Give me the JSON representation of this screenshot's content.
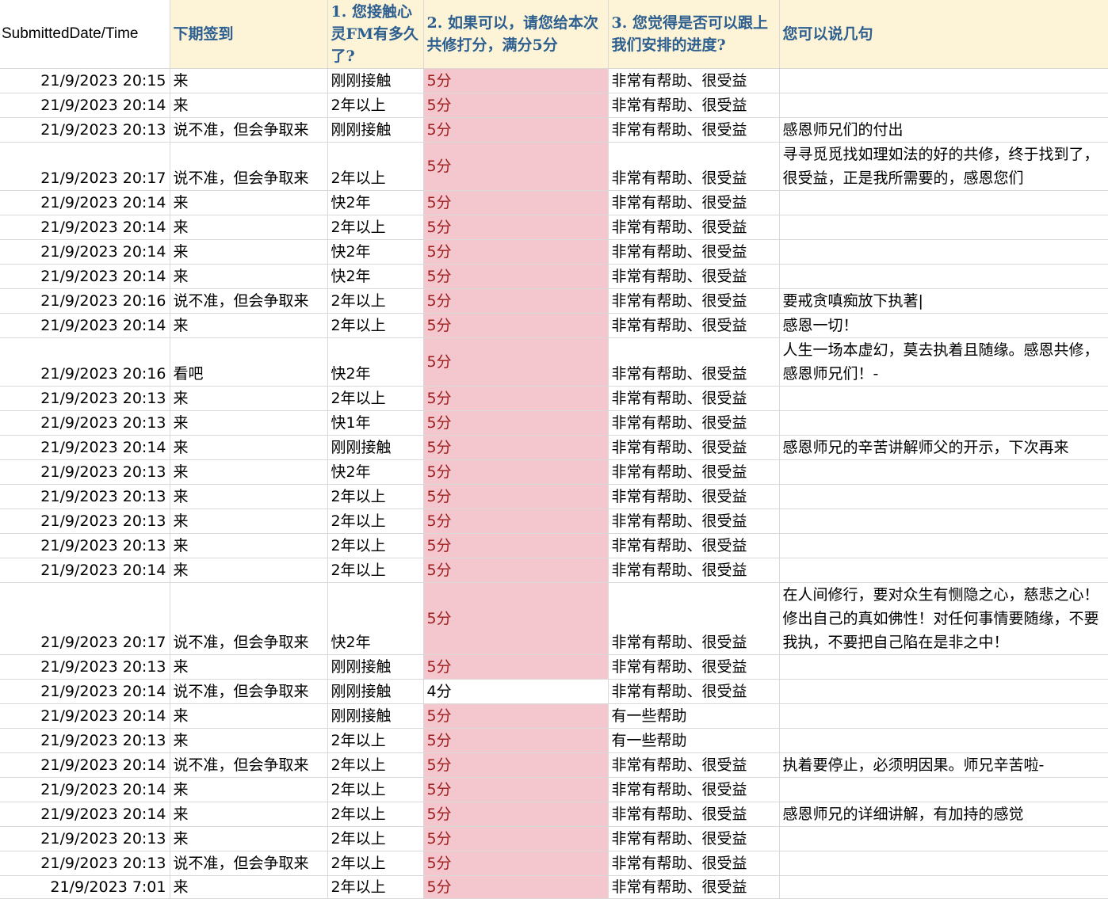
{
  "headers": [
    "SubmittedDate/Time",
    "下期签到",
    "1. 您接触心灵FM有多久了?",
    "2. 如果可以，请您给本次共修打分，满分5分",
    "3. 您觉得是否可以跟上我们安排的进度?",
    "您可以说几句"
  ],
  "rows": [
    {
      "time": "21/9/2023 20:15",
      "signin": "来",
      "duration": "刚刚接触",
      "score": "5分",
      "progress": "非常有帮助、很受益",
      "comment": ""
    },
    {
      "time": "21/9/2023 20:14",
      "signin": "来",
      "duration": "2年以上",
      "score": "5分",
      "progress": "非常有帮助、很受益",
      "comment": ""
    },
    {
      "time": "21/9/2023 20:13",
      "signin": "说不准，但会争取来",
      "duration": "刚刚接触",
      "score": "5分",
      "progress": "非常有帮助、很受益",
      "comment": "感恩师兄们的付出"
    },
    {
      "time": "21/9/2023 20:17",
      "signin": "说不准，但会争取来",
      "duration": "2年以上",
      "score": "5分",
      "progress": "非常有帮助、很受益",
      "comment": "寻寻觅觅找如理如法的好的共修，终于找到了，很受益，正是我所需要的，感恩您们"
    },
    {
      "time": "21/9/2023 20:14",
      "signin": "来",
      "duration": "快2年",
      "score": "5分",
      "progress": "非常有帮助、很受益",
      "comment": ""
    },
    {
      "time": "21/9/2023 20:14",
      "signin": "来",
      "duration": "2年以上",
      "score": "5分",
      "progress": "非常有帮助、很受益",
      "comment": ""
    },
    {
      "time": "21/9/2023 20:14",
      "signin": "来",
      "duration": "快2年",
      "score": "5分",
      "progress": "非常有帮助、很受益",
      "comment": ""
    },
    {
      "time": "21/9/2023 20:14",
      "signin": "来",
      "duration": "快2年",
      "score": "5分",
      "progress": "非常有帮助、很受益",
      "comment": ""
    },
    {
      "time": "21/9/2023 20:16",
      "signin": "说不准，但会争取来",
      "duration": "2年以上",
      "score": "5分",
      "progress": "非常有帮助、很受益",
      "comment": "要戒贪嗔痴放下执著|"
    },
    {
      "time": "21/9/2023 20:14",
      "signin": "来",
      "duration": "2年以上",
      "score": "5分",
      "progress": "非常有帮助、很受益",
      "comment": "感恩一切！"
    },
    {
      "time": "21/9/2023 20:16",
      "signin": "看吧",
      "duration": "快2年",
      "score": "5分",
      "progress": "非常有帮助、很受益",
      "comment": "人生一场本虚幻，莫去执着且随缘。感恩共修，感恩师兄们！-"
    },
    {
      "time": "21/9/2023 20:13",
      "signin": "来",
      "duration": "2年以上",
      "score": "5分",
      "progress": "非常有帮助、很受益",
      "comment": ""
    },
    {
      "time": "21/9/2023 20:13",
      "signin": "来",
      "duration": "快1年",
      "score": "5分",
      "progress": "非常有帮助、很受益",
      "comment": ""
    },
    {
      "time": "21/9/2023 20:14",
      "signin": "来",
      "duration": "刚刚接触",
      "score": "5分",
      "progress": "非常有帮助、很受益",
      "comment": "感恩师兄的辛苦讲解师父的开示，下次再来"
    },
    {
      "time": "21/9/2023 20:13",
      "signin": "来",
      "duration": "快2年",
      "score": "5分",
      "progress": "非常有帮助、很受益",
      "comment": ""
    },
    {
      "time": "21/9/2023 20:13",
      "signin": "来",
      "duration": "2年以上",
      "score": "5分",
      "progress": "非常有帮助、很受益",
      "comment": ""
    },
    {
      "time": "21/9/2023 20:13",
      "signin": "来",
      "duration": "2年以上",
      "score": "5分",
      "progress": "非常有帮助、很受益",
      "comment": ""
    },
    {
      "time": "21/9/2023 20:13",
      "signin": "来",
      "duration": "2年以上",
      "score": "5分",
      "progress": "非常有帮助、很受益",
      "comment": ""
    },
    {
      "time": "21/9/2023 20:14",
      "signin": "来",
      "duration": "2年以上",
      "score": "5分",
      "progress": "非常有帮助、很受益",
      "comment": ""
    },
    {
      "time": "21/9/2023 20:17",
      "signin": "说不准，但会争取来",
      "duration": "快2年",
      "score": "5分",
      "progress": "非常有帮助、很受益",
      "comment": "在人间修行，要对众生有恻隐之心，慈悲之心！修出自己的真如佛性！对任何事情要随缘，不要我执，不要把自己陷在是非之中！"
    },
    {
      "time": "21/9/2023 20:13",
      "signin": "来",
      "duration": "刚刚接触",
      "score": "5分",
      "progress": "非常有帮助、很受益",
      "comment": ""
    },
    {
      "time": "21/9/2023 20:14",
      "signin": "说不准，但会争取来",
      "duration": "刚刚接触",
      "score": "4分",
      "progress": "非常有帮助、很受益",
      "comment": ""
    },
    {
      "time": "21/9/2023 20:14",
      "signin": "来",
      "duration": "刚刚接触",
      "score": "5分",
      "progress": "有一些帮助",
      "comment": ""
    },
    {
      "time": "21/9/2023 20:13",
      "signin": "来",
      "duration": "2年以上",
      "score": "5分",
      "progress": "有一些帮助",
      "comment": ""
    },
    {
      "time": "21/9/2023 20:14",
      "signin": "说不准，但会争取来",
      "duration": "2年以上",
      "score": "5分",
      "progress": "非常有帮助、很受益",
      "comment": "执着要停止，必须明因果。师兄辛苦啦-"
    },
    {
      "time": "21/9/2023 20:14",
      "signin": "来",
      "duration": "2年以上",
      "score": "5分",
      "progress": "非常有帮助、很受益",
      "comment": ""
    },
    {
      "time": "21/9/2023 20:14",
      "signin": "来",
      "duration": "2年以上",
      "score": "5分",
      "progress": "非常有帮助、很受益",
      "comment": "感恩师兄的详细讲解，有加持的感觉"
    },
    {
      "time": "21/9/2023 20:13",
      "signin": "来",
      "duration": "2年以上",
      "score": "5分",
      "progress": "非常有帮助、很受益",
      "comment": ""
    },
    {
      "time": "21/9/2023 20:13",
      "signin": "说不准，但会争取来",
      "duration": "2年以上",
      "score": "5分",
      "progress": "非常有帮助、很受益",
      "comment": ""
    },
    {
      "time": "21/9/2023 7:01",
      "signin": "来",
      "duration": "2年以上",
      "score": "5分",
      "progress": "非常有帮助、很受益",
      "comment": ""
    }
  ],
  "colors": {
    "header_bg": "#fdf4d7",
    "header_text": "#2c5e8f",
    "score_bg": "#f4c7ce",
    "score_text": "#9c1c1c"
  }
}
